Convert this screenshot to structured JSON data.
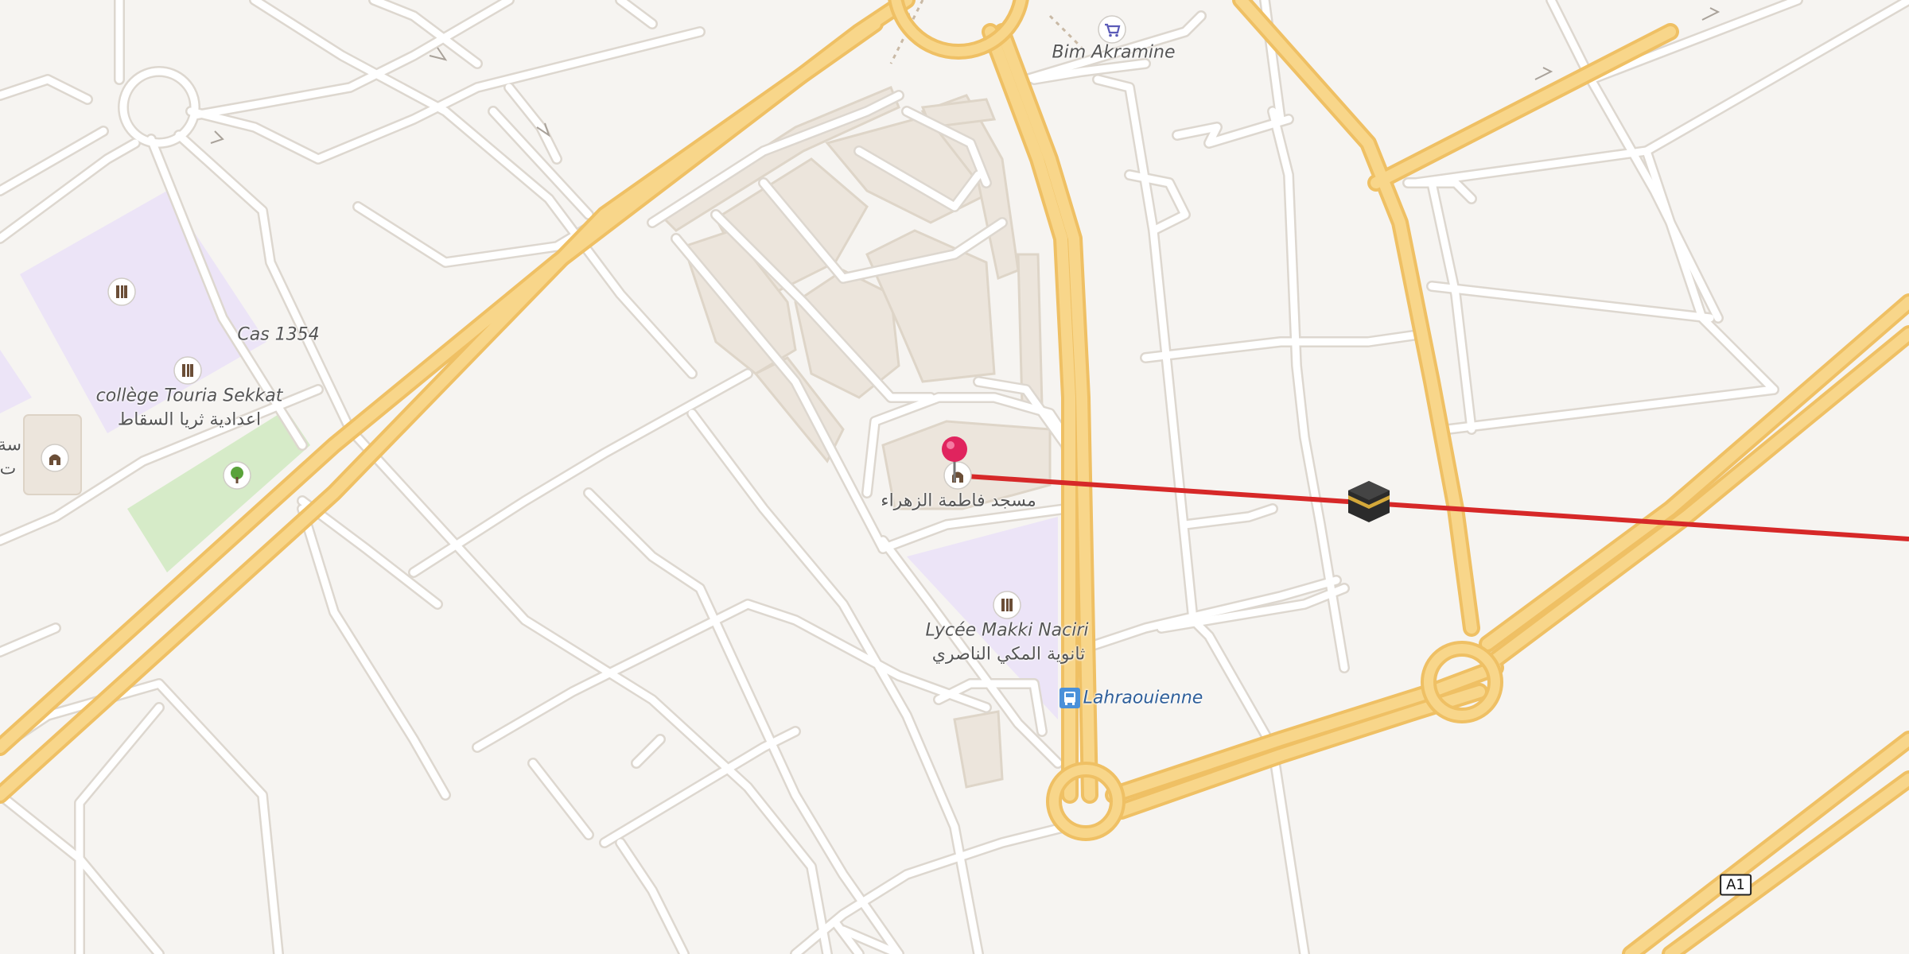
{
  "map": {
    "labels": {
      "bim": "Bim Akramine",
      "cas": "Cas 1354",
      "college_fr": "collège Touria Sekkat",
      "college_ar": "اعدادية ثريا السقاط",
      "mosque_ar": "مسجد فاطمة الزهراء",
      "lycee_fr": "Lycée Makki Naciri",
      "lycee_ar": "ثانوية المكي الناصري",
      "bus_stop": "Lahraouienne",
      "edge_ar_1": "سة",
      "edge_ar_2": "ت"
    },
    "road_shield": "A1",
    "icons": [
      "shopping-cart-icon",
      "school-icon",
      "mosque-icon",
      "park-tree-icon",
      "bus-stop-icon",
      "location-pin-icon",
      "kaaba-icon"
    ],
    "colors": {
      "background": "#f6f4f1",
      "major_road": "#f8d68a",
      "major_road_casing": "#efc064",
      "minor_road": "#ffffff",
      "school_area": "#ece4f7",
      "park_area": "#d6ebc8",
      "residential_block": "#ece5dc",
      "qibla_line": "#d62828",
      "pin": "#e0245e",
      "bus_stop": "#4a90d9"
    }
  }
}
